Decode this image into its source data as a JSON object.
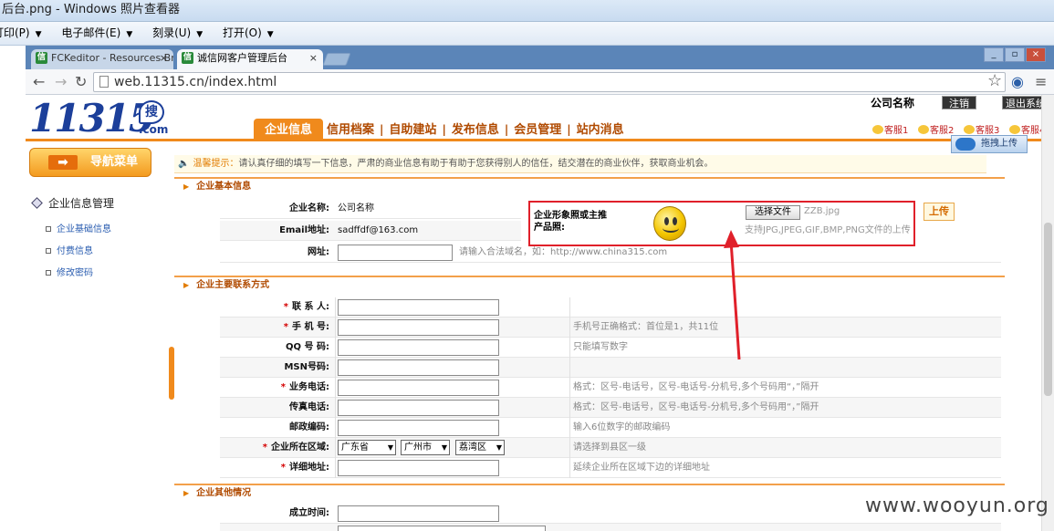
{
  "viewer": {
    "title": "后台.png - Windows 照片查看器",
    "menu": [
      {
        "label": "打印(P)"
      },
      {
        "label": "电子邮件(E)"
      },
      {
        "label": "刻录(U)"
      },
      {
        "label": "打开(O)"
      }
    ]
  },
  "browser": {
    "tabs": [
      {
        "label": "FCKeditor - Resources Brow"
      },
      {
        "label": "诚信网客户管理后台"
      }
    ],
    "url": "web.11315.cn/index.html",
    "window_buttons": [
      "_",
      "▫",
      "×"
    ]
  },
  "site": {
    "logo": "11315",
    "logo_so": "搜",
    "logo_com": ".com",
    "company_name": "公司名称",
    "logout": "注销",
    "exit": "退出系统",
    "nav": [
      "企业信息",
      "信用档案",
      "自助建站",
      "发布信息",
      "会员管理",
      "站内消息"
    ],
    "kefu": [
      "客服1",
      "客服2",
      "客服3",
      "客服4"
    ],
    "drag_upload": "拖拽上传"
  },
  "sidebar": {
    "menu_button": "导航菜单",
    "section": "企业信息管理",
    "links": [
      "企业基础信息",
      "付费信息",
      "修改密码"
    ]
  },
  "tip": {
    "prefix": "温馨提示：",
    "text": "请认真仔细的填写一下信息，严肃的商业信息有助于有助于您获得别人的信任，结交潜在的商业伙伴，获取商业机会。"
  },
  "basic": {
    "title": "企业基本信息",
    "name_label": "企业名称:",
    "name_value": "公司名称",
    "email_label": "Email地址:",
    "email_value": "sadffdf@163.com",
    "url_label": "网址:",
    "url_hint": "请输入合法域名，如：http://www.china315.com",
    "image_label": "企业形象照或主推产品照:",
    "choose_file": "选择文件",
    "file_name": "ZZB.jpg",
    "image_hint": "支持JPG,JPEG,GIF,BMP,PNG文件的上传",
    "upload": "上传"
  },
  "contact": {
    "title": "企业主要联系方式",
    "rows": [
      {
        "label": "联 系 人:",
        "required": "*",
        "hint": ""
      },
      {
        "label": "手 机 号:",
        "required": "*",
        "hint": "手机号正确格式：首位是1，共11位"
      },
      {
        "label": "QQ 号 码:",
        "required": "",
        "hint": "只能填写数字"
      },
      {
        "label": "MSN号码:",
        "required": "",
        "hint": ""
      },
      {
        "label": "业务电话:",
        "required": "*",
        "hint": "格式：区号-电话号，区号-电话号-分机号,多个号码用“，”隔开"
      },
      {
        "label": "传真电话:",
        "required": "",
        "hint": "格式：区号-电话号，区号-电话号-分机号,多个号码用“，”隔开"
      },
      {
        "label": "邮政编码:",
        "required": "",
        "hint": "输入6位数字的邮政编码"
      },
      {
        "label": "企业所在区域:",
        "required": "*",
        "hint": "请选择到县区一级"
      },
      {
        "label": "详细地址:",
        "required": "*",
        "hint": "延续企业所在区域下边的详细地址"
      }
    ],
    "province": "广东省",
    "city": "广州市",
    "district": "荔湾区"
  },
  "other": {
    "title": "企业其他情况",
    "founded_label": "成立时间:"
  },
  "watermark": "www.wooyun.org",
  "colors": {
    "accent": "#f08a1c",
    "highlight": "#e0202a",
    "logo": "#1c3f9a"
  }
}
